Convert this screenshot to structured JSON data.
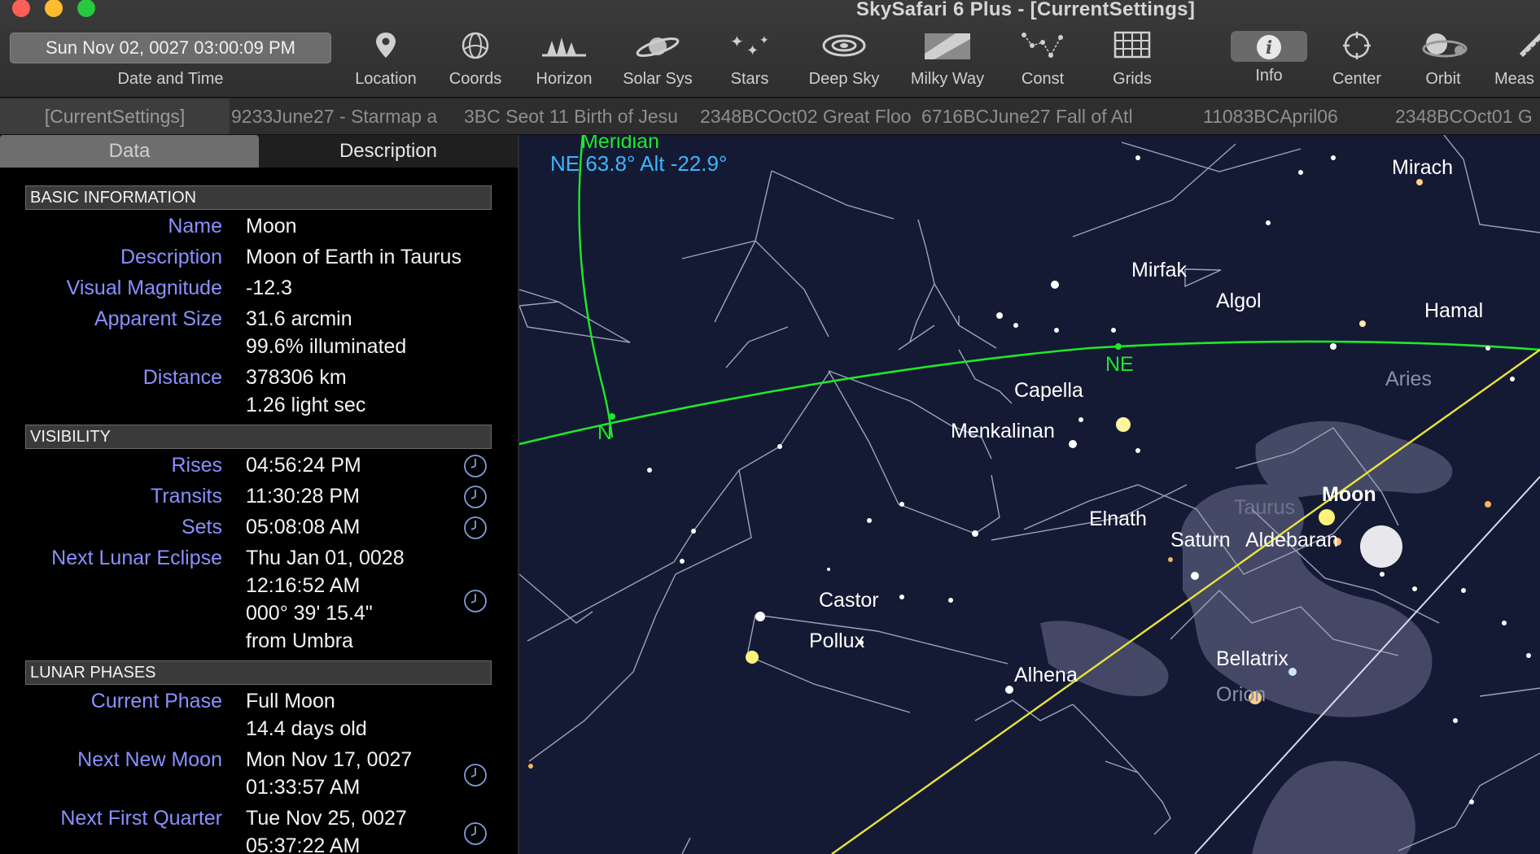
{
  "window": {
    "title": "SkySafari 6 Plus - [CurrentSettings]"
  },
  "toolbar": {
    "datetime_value": "Sun Nov 02, 0027  03:00:09 PM",
    "datetime_label": "Date and Time",
    "tools": [
      {
        "label": "Location",
        "icon": "location-pin-icon"
      },
      {
        "label": "Coords",
        "icon": "coords-icon"
      },
      {
        "label": "Horizon",
        "icon": "horizon-icon"
      },
      {
        "label": "Solar Sys",
        "icon": "planet-icon"
      },
      {
        "label": "Stars",
        "icon": "stars-icon"
      },
      {
        "label": "Deep Sky",
        "icon": "galaxy-icon"
      },
      {
        "label": "Milky Way",
        "icon": "milky-way-icon"
      },
      {
        "label": "Const",
        "icon": "constellation-icon"
      },
      {
        "label": "Grids",
        "icon": "grid-icon"
      },
      {
        "label": "Info",
        "icon": "info-icon"
      },
      {
        "label": "Center",
        "icon": "center-icon"
      },
      {
        "label": "Orbit",
        "icon": "orbit-icon"
      },
      {
        "label": "Meas",
        "icon": "measure-icon"
      }
    ]
  },
  "settings_tabs": [
    "[CurrentSettings]",
    "9233June27 - Starmap a",
    "3BC Seot 11 Birth of Jesu",
    "2348BCOct02 Great Floo",
    "6716BCJune27 Fall of Atl",
    "11083BCApril06",
    "2348BCOct01 G"
  ],
  "panel": {
    "tabs": [
      "Data",
      "Description"
    ],
    "basic_header": "BASIC INFORMATION",
    "name_key": "Name",
    "name_val": "Moon",
    "desc_key": "Description",
    "desc_val": "Moon of Earth in Taurus",
    "mag_key": "Visual Magnitude",
    "mag_val": "-12.3",
    "size_key": "Apparent Size",
    "size_val": "31.6 arcmin",
    "size_val2": "99.6% illuminated",
    "dist_key": "Distance",
    "dist_val": "378306 km",
    "dist_val2": "1.26 light sec",
    "visibility_header": "VISIBILITY",
    "rises_key": "Rises",
    "rises_val": "04:56:24 PM",
    "transits_key": "Transits",
    "transits_val": "11:30:28 PM",
    "sets_key": "Sets",
    "sets_val": "05:08:08 AM",
    "eclipse_key": "Next Lunar Eclipse",
    "eclipse_val": "Thu Jan 01, 0028",
    "eclipse_val2": "12:16:52 AM",
    "eclipse_val3": "000° 39' 15.4\"",
    "eclipse_val4": "from Umbra",
    "phases_header": "LUNAR PHASES",
    "phase_key": "Current Phase",
    "phase_val": "Full Moon",
    "phase_val2": "14.4 days old",
    "newmoon_key": "Next New Moon",
    "newmoon_val": "Mon Nov 17, 0027",
    "newmoon_val2": "01:33:57 AM",
    "firstq_key": "Next First Quarter",
    "firstq_val": "Tue Nov 25, 0027",
    "firstq_val2": "05:37:22 AM"
  },
  "sky": {
    "cursor_readout": "NE 63.8° Alt -22.9°",
    "meridian_label": "Meridian",
    "north_label": "N",
    "northeast_label": "NE",
    "stars": [
      "Mirach",
      "Mirfak",
      "Algol",
      "Hamal",
      "Capella",
      "Menkalinan",
      "Elnath",
      "Saturn",
      "Aldebaran",
      "Moon",
      "Castor",
      "Pollux",
      "Alhena",
      "Bellatrix"
    ],
    "constellations": [
      "Aries",
      "Taurus",
      "Orion"
    ],
    "colors": {
      "horizon": "#1ee82a",
      "ecliptic": "#e9e33b",
      "readout": "#3bb6ff",
      "sky": "#141a33"
    }
  }
}
